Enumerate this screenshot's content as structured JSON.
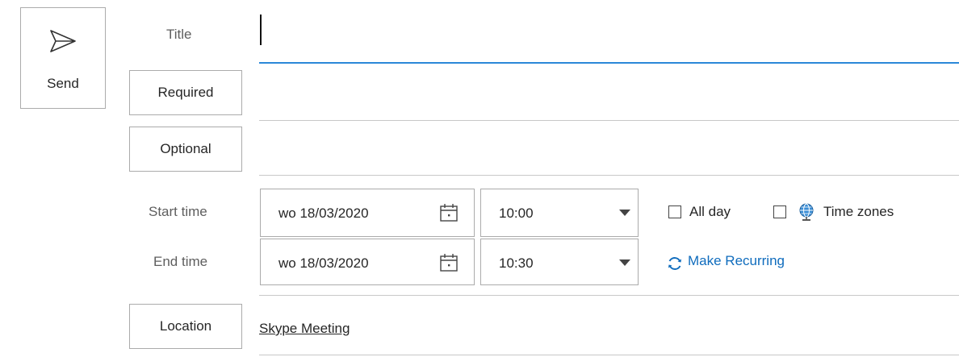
{
  "send": {
    "label": "Send",
    "icon": "send-icon"
  },
  "fields": {
    "title_label": "Title",
    "title_value": "",
    "required_label": "Required",
    "optional_label": "Optional",
    "location_label": "Location",
    "location_value": "Skype Meeting"
  },
  "time": {
    "start_label": "Start time",
    "end_label": "End time",
    "start_date": "wo 18/03/2020",
    "end_date": "wo 18/03/2020",
    "start_time": "10:00",
    "end_time": "10:30",
    "calendar_icon": "calendar-icon",
    "dropdown_icon": "chevron-down-icon"
  },
  "options": {
    "all_day_label": "All day",
    "all_day_checked": false,
    "time_zones_label": "Time zones",
    "time_zones_checked": false,
    "time_zones_icon": "globe-icon",
    "make_recurring_label": "Make Recurring",
    "make_recurring_icon": "recurring-icon"
  },
  "colors": {
    "accent": "#2b88d8",
    "link": "#0f6cbd"
  }
}
